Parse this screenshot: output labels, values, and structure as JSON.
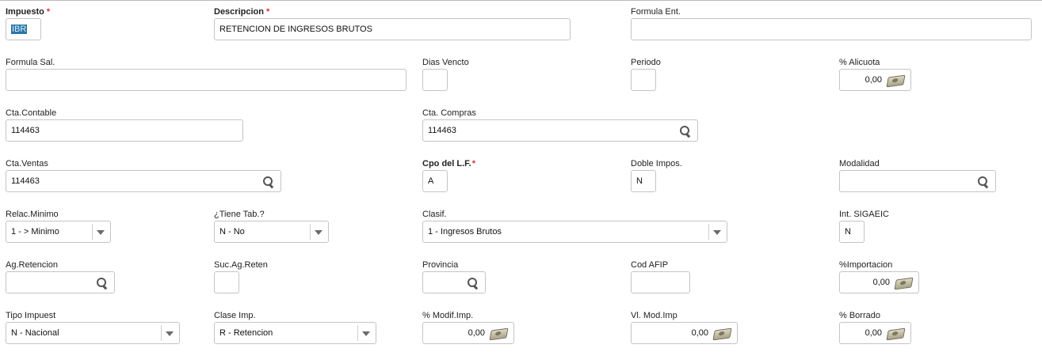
{
  "impuesto": {
    "label": "Impuesto",
    "required": "*",
    "value": "IBR"
  },
  "descripcion": {
    "label": "Descripcion",
    "required": "*",
    "value": "RETENCION DE INGRESOS BRUTOS"
  },
  "formula_ent": {
    "label": "Formula Ent.",
    "value": ""
  },
  "formula_sal": {
    "label": "Formula Sal.",
    "value": ""
  },
  "dias_vencto": {
    "label": "Dias Vencto",
    "value": ""
  },
  "periodo": {
    "label": "Periodo",
    "value": ""
  },
  "alicuota": {
    "label": "% Alicuota",
    "value": "0,00",
    "icon": "calculator-icon"
  },
  "cta_contable": {
    "label": "Cta.Contable",
    "value": "114463"
  },
  "cta_compras": {
    "label": "Cta. Compras",
    "value": "114463",
    "icon": "search-icon"
  },
  "cta_ventas": {
    "label": "Cta.Ventas",
    "value": "114463",
    "icon": "search-icon"
  },
  "cpo_lf": {
    "label": "Cpo del L.F.",
    "required": "*",
    "value": "A"
  },
  "doble_impos": {
    "label": "Doble Impos.",
    "value": "N"
  },
  "modalidad": {
    "label": "Modalidad",
    "value": "",
    "icon": "search-icon"
  },
  "relac_minimo": {
    "label": "Relac.Minimo",
    "value": "1 -  > Minimo"
  },
  "tiene_tab": {
    "label": "¿Tiene Tab.?",
    "value": "N -  No"
  },
  "clasif": {
    "label": "Clasif.",
    "value": "1 - Ingresos Brutos"
  },
  "int_sigaeic": {
    "label": "Int. SIGAEIC",
    "value": "N"
  },
  "ag_retencion": {
    "label": "Ag.Retencion",
    "value": "",
    "icon": "search-icon"
  },
  "suc_ag_reten": {
    "label": "Suc.Ag.Reten",
    "value": ""
  },
  "provincia": {
    "label": "Provincia",
    "value": "",
    "icon": "search-icon"
  },
  "cod_afip": {
    "label": "Cod AFIP",
    "value": ""
  },
  "importacion": {
    "label": "%Importacion",
    "value": "0,00"
  },
  "tipo_impuest": {
    "label": "Tipo Impuest",
    "value": "N - Nacional"
  },
  "clase_imp": {
    "label": "Clase Imp.",
    "value": "R - Retencion"
  },
  "modif_imp": {
    "label": "% Modif.Imp.",
    "value": "0,00"
  },
  "vl_mod_imp": {
    "label": "Vl. Mod.Imp",
    "value": "0,00"
  },
  "borrado": {
    "label": "% Borrado",
    "value": "0,00"
  }
}
